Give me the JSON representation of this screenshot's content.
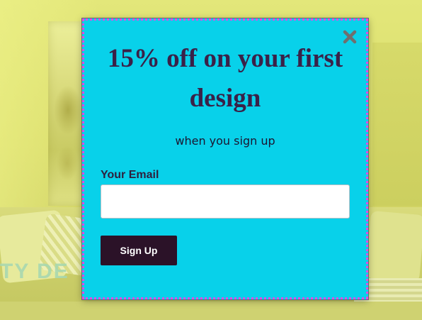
{
  "background": {
    "brand_text": "TY DE",
    "scene_tint": "#d6d86a"
  },
  "popup": {
    "headline": "15% off on your first design",
    "subheadline": "when you sign up",
    "email_label": "Your Email",
    "email_value": "",
    "email_placeholder": "",
    "submit_label": "Sign Up",
    "close_icon": "close-x-icon",
    "colors": {
      "background": "#08d1ea",
      "border": "#e14be6",
      "headline": "#3a2148",
      "button": "#2b1228",
      "button_text": "#ffffff"
    }
  }
}
